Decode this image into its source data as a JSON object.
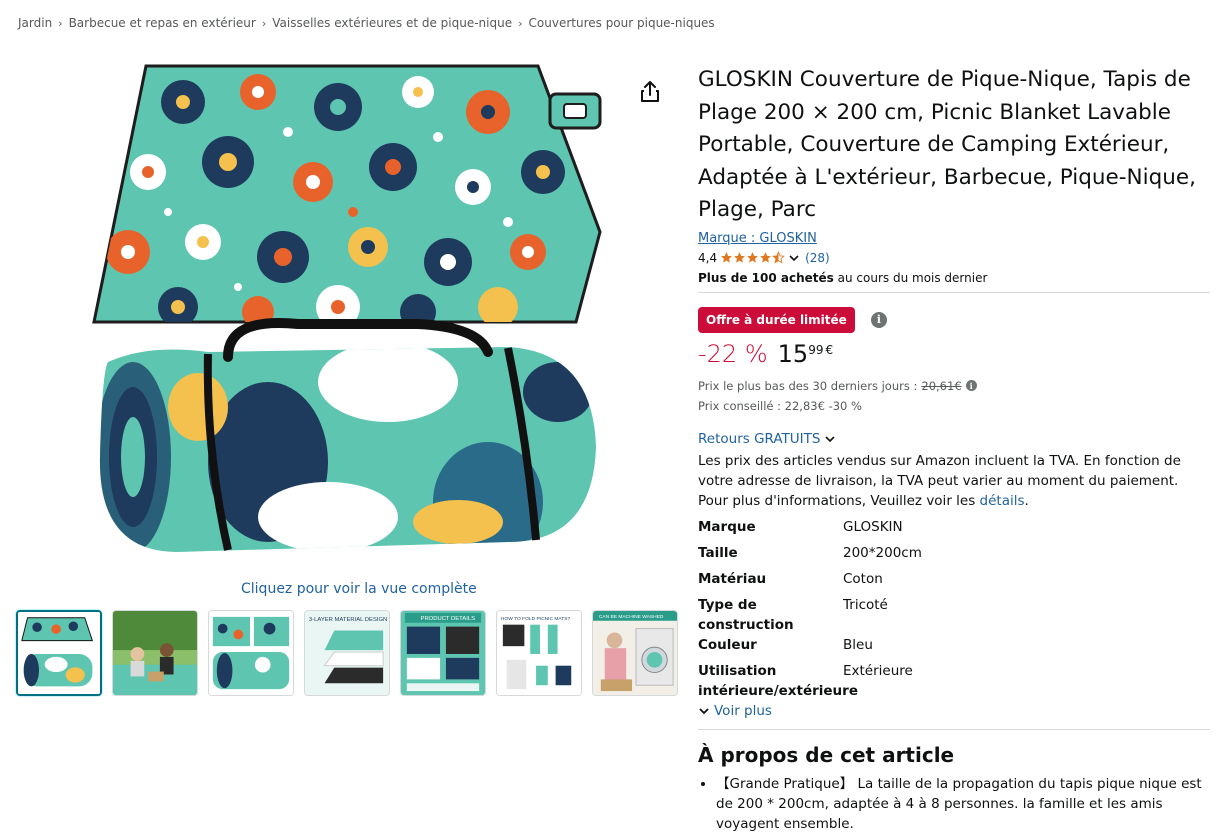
{
  "breadcrumb": [
    "Jardin",
    "Barbecue et repas en extérieur",
    "Vaisselles extérieures et de pique-nique",
    "Couvertures pour pique-niques"
  ],
  "breadcrumb_separator": "›",
  "product": {
    "title": "GLOSKIN Couverture de Pique-Nique, Tapis de Plage 200 × 200 cm, Picnic Blanket Lavable Portable, Couverture de Camping Extérieur, Adaptée à L'extérieur, Barbecue, Pique-Nique, Plage, Parc",
    "brand_link": "Marque : GLOSKIN",
    "rating_value": "4,4",
    "rating_count": "(28)",
    "bought_bold": "Plus de 100 achetés",
    "bought_rest": " au cours du mois dernier"
  },
  "deal": {
    "badge": "Offre à durée limitée",
    "discount": "-22 %",
    "price_whole": "15",
    "price_fraction": "99",
    "currency": "€",
    "lowest_label": "Prix le plus bas des 30 derniers jours : ",
    "lowest_value": "20,61€",
    "rrp": "Prix conseillé : 22,83€ -30 %"
  },
  "returns_label": "Retours GRATUITS",
  "vat": {
    "text": "Les prix des articles vendus sur Amazon incluent la TVA. En fonction de votre adresse de livraison, la TVA peut varier au moment du paiement. Pour plus d'informations, Veuillez voir les ",
    "link": "détails",
    "end": "."
  },
  "specs": [
    {
      "key": "Marque",
      "value": "GLOSKIN"
    },
    {
      "key": "Taille",
      "value": "200*200cm"
    },
    {
      "key": "Matériau",
      "value": "Coton"
    },
    {
      "key": "Type de construction",
      "value": "Tricoté"
    },
    {
      "key": "Couleur",
      "value": "Bleu"
    },
    {
      "key": "Utilisation intérieure/extérieure",
      "value": "Extérieure"
    }
  ],
  "see_more": "Voir plus",
  "about": {
    "title": "À propos de cet article",
    "items": [
      "【Grande Pratique】 La taille de la propagation du tapis pique nique est de 200 * 200cm, adaptée à 4 à 8 personnes. la famille et les amis voyagent ensemble."
    ]
  },
  "gallery": {
    "view_full": "Cliquez pour voir la vue complète",
    "thumbnails": [
      {
        "name": "thumbnail-product-main"
      },
      {
        "name": "thumbnail-family-picnic"
      },
      {
        "name": "thumbnail-blanket-pattern"
      },
      {
        "name": "thumbnail-3-layer-material",
        "caption": "3-LAYER MATERIAL DESIGN"
      },
      {
        "name": "thumbnail-product-details",
        "caption": "PRODUCT DETAILS"
      },
      {
        "name": "thumbnail-how-to-fold",
        "caption": "HOW TO FOLD PICNIC MATS?"
      },
      {
        "name": "thumbnail-machine-washed",
        "caption": "CAN BE MACHINE WASHED"
      }
    ]
  },
  "colors": {
    "link": "#2162a1",
    "deal_red": "#cc0c39",
    "star": "#de7921",
    "mat_teal": "#5ec5b0",
    "mat_navy": "#1e3a5c",
    "mat_orange": "#e8632b",
    "mat_yellow": "#f4c04e"
  },
  "icons": {
    "share": "share-icon",
    "info": "info-icon",
    "chevron": "chevron-down-icon",
    "star": "star-icon"
  }
}
